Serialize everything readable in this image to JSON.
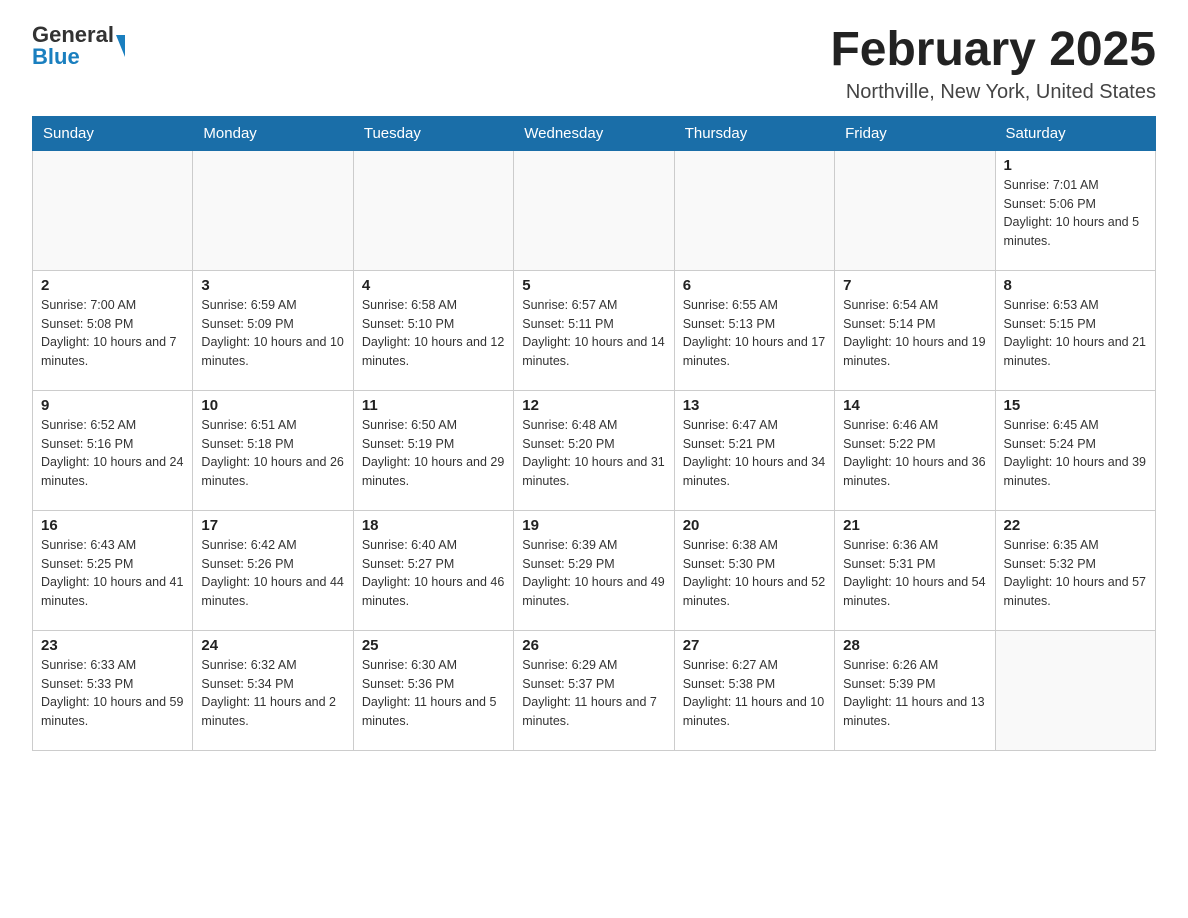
{
  "logo": {
    "general": "General",
    "blue": "Blue"
  },
  "title": "February 2025",
  "location": "Northville, New York, United States",
  "days_of_week": [
    "Sunday",
    "Monday",
    "Tuesday",
    "Wednesday",
    "Thursday",
    "Friday",
    "Saturday"
  ],
  "weeks": [
    [
      {
        "day": "",
        "info": ""
      },
      {
        "day": "",
        "info": ""
      },
      {
        "day": "",
        "info": ""
      },
      {
        "day": "",
        "info": ""
      },
      {
        "day": "",
        "info": ""
      },
      {
        "day": "",
        "info": ""
      },
      {
        "day": "1",
        "info": "Sunrise: 7:01 AM\nSunset: 5:06 PM\nDaylight: 10 hours and 5 minutes."
      }
    ],
    [
      {
        "day": "2",
        "info": "Sunrise: 7:00 AM\nSunset: 5:08 PM\nDaylight: 10 hours and 7 minutes."
      },
      {
        "day": "3",
        "info": "Sunrise: 6:59 AM\nSunset: 5:09 PM\nDaylight: 10 hours and 10 minutes."
      },
      {
        "day": "4",
        "info": "Sunrise: 6:58 AM\nSunset: 5:10 PM\nDaylight: 10 hours and 12 minutes."
      },
      {
        "day": "5",
        "info": "Sunrise: 6:57 AM\nSunset: 5:11 PM\nDaylight: 10 hours and 14 minutes."
      },
      {
        "day": "6",
        "info": "Sunrise: 6:55 AM\nSunset: 5:13 PM\nDaylight: 10 hours and 17 minutes."
      },
      {
        "day": "7",
        "info": "Sunrise: 6:54 AM\nSunset: 5:14 PM\nDaylight: 10 hours and 19 minutes."
      },
      {
        "day": "8",
        "info": "Sunrise: 6:53 AM\nSunset: 5:15 PM\nDaylight: 10 hours and 21 minutes."
      }
    ],
    [
      {
        "day": "9",
        "info": "Sunrise: 6:52 AM\nSunset: 5:16 PM\nDaylight: 10 hours and 24 minutes."
      },
      {
        "day": "10",
        "info": "Sunrise: 6:51 AM\nSunset: 5:18 PM\nDaylight: 10 hours and 26 minutes."
      },
      {
        "day": "11",
        "info": "Sunrise: 6:50 AM\nSunset: 5:19 PM\nDaylight: 10 hours and 29 minutes."
      },
      {
        "day": "12",
        "info": "Sunrise: 6:48 AM\nSunset: 5:20 PM\nDaylight: 10 hours and 31 minutes."
      },
      {
        "day": "13",
        "info": "Sunrise: 6:47 AM\nSunset: 5:21 PM\nDaylight: 10 hours and 34 minutes."
      },
      {
        "day": "14",
        "info": "Sunrise: 6:46 AM\nSunset: 5:22 PM\nDaylight: 10 hours and 36 minutes."
      },
      {
        "day": "15",
        "info": "Sunrise: 6:45 AM\nSunset: 5:24 PM\nDaylight: 10 hours and 39 minutes."
      }
    ],
    [
      {
        "day": "16",
        "info": "Sunrise: 6:43 AM\nSunset: 5:25 PM\nDaylight: 10 hours and 41 minutes."
      },
      {
        "day": "17",
        "info": "Sunrise: 6:42 AM\nSunset: 5:26 PM\nDaylight: 10 hours and 44 minutes."
      },
      {
        "day": "18",
        "info": "Sunrise: 6:40 AM\nSunset: 5:27 PM\nDaylight: 10 hours and 46 minutes."
      },
      {
        "day": "19",
        "info": "Sunrise: 6:39 AM\nSunset: 5:29 PM\nDaylight: 10 hours and 49 minutes."
      },
      {
        "day": "20",
        "info": "Sunrise: 6:38 AM\nSunset: 5:30 PM\nDaylight: 10 hours and 52 minutes."
      },
      {
        "day": "21",
        "info": "Sunrise: 6:36 AM\nSunset: 5:31 PM\nDaylight: 10 hours and 54 minutes."
      },
      {
        "day": "22",
        "info": "Sunrise: 6:35 AM\nSunset: 5:32 PM\nDaylight: 10 hours and 57 minutes."
      }
    ],
    [
      {
        "day": "23",
        "info": "Sunrise: 6:33 AM\nSunset: 5:33 PM\nDaylight: 10 hours and 59 minutes."
      },
      {
        "day": "24",
        "info": "Sunrise: 6:32 AM\nSunset: 5:34 PM\nDaylight: 11 hours and 2 minutes."
      },
      {
        "day": "25",
        "info": "Sunrise: 6:30 AM\nSunset: 5:36 PM\nDaylight: 11 hours and 5 minutes."
      },
      {
        "day": "26",
        "info": "Sunrise: 6:29 AM\nSunset: 5:37 PM\nDaylight: 11 hours and 7 minutes."
      },
      {
        "day": "27",
        "info": "Sunrise: 6:27 AM\nSunset: 5:38 PM\nDaylight: 11 hours and 10 minutes."
      },
      {
        "day": "28",
        "info": "Sunrise: 6:26 AM\nSunset: 5:39 PM\nDaylight: 11 hours and 13 minutes."
      },
      {
        "day": "",
        "info": ""
      }
    ]
  ]
}
